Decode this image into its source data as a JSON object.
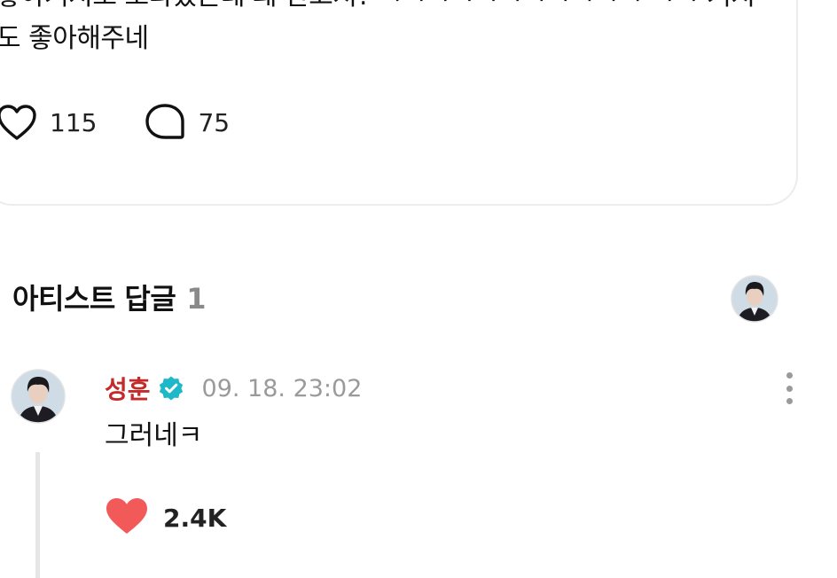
{
  "post": {
    "text": "좋아거지도 오타났는데 왜 안고쳐? ㅋㅋㅋㅋㅋㅋㅋㅋㅋㅋㅋ ㅋㅋ 거지도 좋아해주네",
    "like_count": "115",
    "comment_count": "75",
    "icons": {
      "like": "heart-outline-icon",
      "comment": "speech-bubble-icon"
    }
  },
  "artist_replies": {
    "title": "아티스트 답글",
    "count": "1"
  },
  "reply": {
    "author": "성훈",
    "timestamp": "09. 18. 23:02",
    "text": "그러네ㅋ",
    "like_count": "2.4K",
    "colors": {
      "author": "#c42a2a",
      "verified_badge": "#1fb8c9",
      "liked_heart": "#f25a5a"
    },
    "icons": {
      "verified": "verified-badge-icon",
      "like": "heart-filled-icon",
      "more": "more-vertical-icon"
    }
  }
}
